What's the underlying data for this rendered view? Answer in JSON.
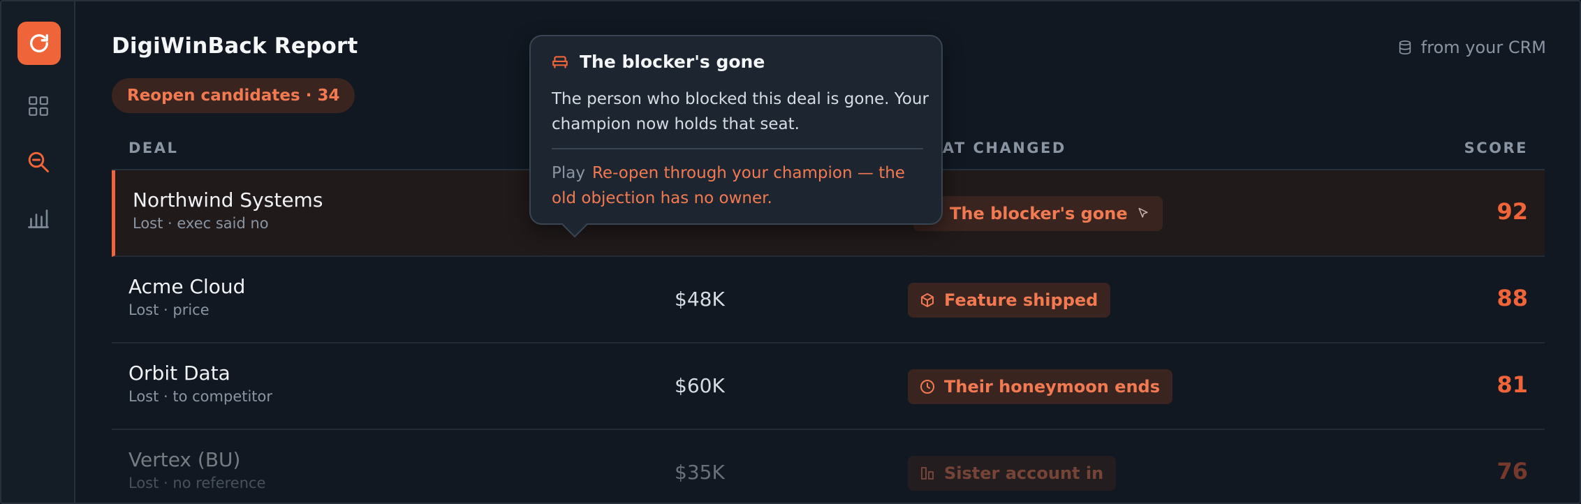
{
  "app": {
    "title": "DigiWinBack Report",
    "source_label": "from your CRM",
    "accent": "#f0643a"
  },
  "sidebar": {
    "items": [
      {
        "icon": "grid-icon",
        "active": false
      },
      {
        "icon": "search-minus-icon",
        "active": true
      },
      {
        "icon": "bar-chart-icon",
        "active": false
      }
    ]
  },
  "filter_pill": "Reopen candidates · 34",
  "table": {
    "headers": {
      "deal": "DEAL",
      "changed": "WHAT CHANGED",
      "score": "SCORE"
    },
    "rows": [
      {
        "name": "Northwind Systems",
        "sub": "Lost · exec said no",
        "value": "",
        "change": "The blocker's gone",
        "change_icon": "sofa-icon",
        "score": "92"
      },
      {
        "name": "Acme Cloud",
        "sub": "Lost · price",
        "value": "$48K",
        "change": "Feature shipped",
        "change_icon": "box-icon",
        "score": "88"
      },
      {
        "name": "Orbit Data",
        "sub": "Lost · to competitor",
        "value": "$60K",
        "change": "Their honeymoon ends",
        "change_icon": "clock-icon",
        "score": "81"
      },
      {
        "name": "Vertex (BU)",
        "sub": "Lost · no reference",
        "value": "$35K",
        "change": "Sister account in",
        "change_icon": "buildings-icon",
        "score": "76"
      }
    ]
  },
  "tooltip": {
    "title": "The blocker's gone",
    "body": "The person who blocked this deal is gone. Your champion now holds that seat.",
    "play_label": "Play",
    "play_text": "Re-open through your champion — the old objection has no owner."
  }
}
